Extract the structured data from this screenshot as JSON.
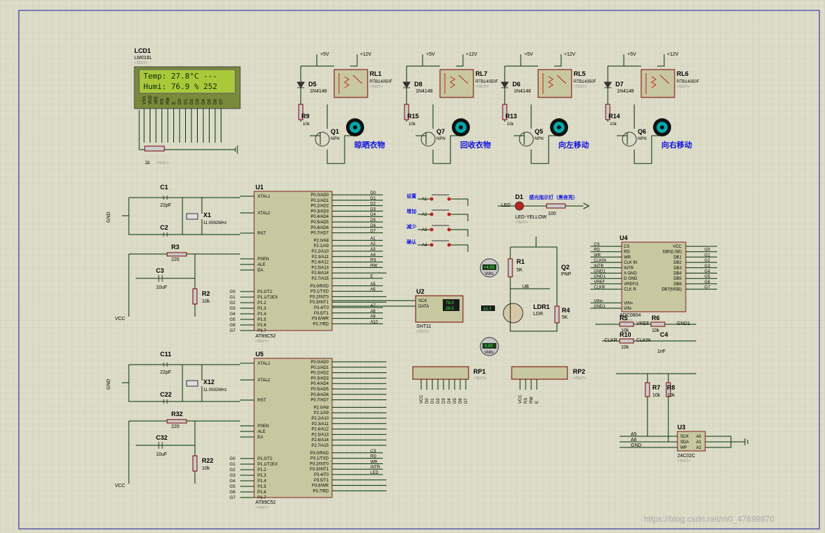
{
  "lcd": {
    "ref": "LCD1",
    "part": "LM016L",
    "line1": "Temp: 27.8°C ---",
    "line2": "Humi: 76.9 % 252",
    "pins": [
      "VSS",
      "VDD",
      "VEE",
      "RS",
      "RW",
      "E",
      "D0",
      "D1",
      "D2",
      "D3",
      "D4",
      "D5",
      "D6",
      "D7"
    ]
  },
  "relays": [
    {
      "diode": "D5",
      "relay": "RL1",
      "part": "RTB14050F",
      "res": "R9",
      "trans": "Q1",
      "label": "晾晒衣物"
    },
    {
      "diode": "D8",
      "relay": "RL7",
      "part": "RTB14050F",
      "res": "R15",
      "trans": "Q7",
      "label": "回收衣物"
    },
    {
      "diode": "D6",
      "relay": "RL5",
      "part": "RTB14050F",
      "res": "R13",
      "trans": "Q5",
      "label": "向左移动"
    },
    {
      "diode": "D7",
      "relay": "RL6",
      "part": "RTB14050F",
      "res": "R14",
      "trans": "Q6",
      "label": "向右移动"
    }
  ],
  "common": {
    "v5": "+5V",
    "v12": "+12V",
    "diode_part": "1N4148",
    "r10k": "10k",
    "npn": "NPN",
    "pnp": "PNP",
    "text": "<TEXT>",
    "gnd": "GND",
    "vcc": "VCC",
    "xtal_freq": "11.0592MHz",
    "cap22": "22pF",
    "cap10u": "10uF",
    "r220": "220",
    "r1k": "1k",
    "r5k": "5K",
    "cap1n": "1nF",
    "r100": "100"
  },
  "u1": {
    "ref": "U1",
    "part": "AT89C52",
    "left": [
      "XTAL1",
      "XTAL2",
      "RST",
      "PSEN",
      "ALE",
      "EA",
      "P1.0/T2",
      "P1.1/T2EX",
      "P1.2",
      "P1.3",
      "P1.4",
      "P1.5",
      "P1.6",
      "P1.7"
    ],
    "right": [
      "P0.0/AD0",
      "P0.1/AD1",
      "P0.2/AD2",
      "P0.3/AD3",
      "P0.4/AD4",
      "P0.5/AD5",
      "P0.6/AD6",
      "P0.7/AD7",
      "P2.0/A8",
      "P2.1/A9",
      "P2.2/A10",
      "P2.3/A11",
      "P2.4/A12",
      "P2.5/A13",
      "P2.6/A14",
      "P2.7/A15",
      "P3.0/RXD",
      "P3.1/TXD",
      "P3.2/INT0",
      "P3.3/INT1",
      "P3.4/T0",
      "P3.5/T1",
      "P3.6/WR",
      "P3.7/RD"
    ],
    "nets_right": [
      "D0",
      "D1",
      "D2",
      "D3",
      "D4",
      "D5",
      "D6",
      "D7",
      "A1",
      "A2",
      "A3",
      "A4",
      "RS",
      "RW",
      "",
      "E",
      "A5",
      "A6",
      "",
      "",
      "A7",
      "A8",
      "A9",
      "A10"
    ],
    "nets_left": [
      "G0",
      "G1",
      "G2",
      "G3",
      "G4",
      "G5",
      "G6",
      "G7"
    ]
  },
  "u5": {
    "ref": "U5",
    "part": "AT89C52",
    "nets_right": [
      "",
      "",
      "",
      "",
      "",
      "",
      "",
      "",
      "",
      "",
      "",
      "",
      "",
      "",
      "",
      "",
      "CS",
      "RD",
      "WR",
      "INTR",
      "LED",
      "",
      "",
      ""
    ]
  },
  "buttons": [
    "设置",
    "增加",
    "减少",
    "确认"
  ],
  "button_nets": [
    "A1",
    "A2",
    "A3",
    "A4"
  ],
  "led": {
    "ref": "D1",
    "part": "LED-YELLOW",
    "net": "LED",
    "label": "感光指示灯（黑夜亮）",
    "res": "R13"
  },
  "sht": {
    "ref": "U2",
    "part": "SHT11",
    "t": "78.0",
    "h": "28.0",
    "pins": [
      "SCK",
      "DATA"
    ]
  },
  "meters": [
    {
      "val": "+4.93",
      "unit": "Volts"
    },
    {
      "val": "0.00",
      "unit": "Volts"
    }
  ],
  "ldr": {
    "ref": "LDR1",
    "part": "LDR",
    "val": "10.7"
  },
  "adc": {
    "ref": "U4",
    "part": "ADC0804",
    "left": [
      "CS",
      "RD",
      "WR",
      "CLK IN",
      "INTR",
      "A GND",
      "D GND",
      "VREF/2",
      "CLK R",
      "VIN+",
      "VIN-"
    ],
    "right": [
      "VCC",
      "DB0(LSB)",
      "DB1",
      "DB2",
      "DB3",
      "DB4",
      "DB5",
      "DB6",
      "DB7(MSB)"
    ],
    "nets_left": [
      "CS",
      "RD",
      "WR",
      "CLKIN",
      "INTR",
      "GND1",
      "GND1",
      "VREF",
      "CLKR",
      "VIN+",
      "GND1"
    ],
    "nets_right": [
      "",
      "G0",
      "G1",
      "G2",
      "G3",
      "G4",
      "G5",
      "G6",
      "G7"
    ]
  },
  "eeprom": {
    "ref": "U3",
    "part": "24C02C",
    "pins": [
      "SCK",
      "SDA",
      "WP",
      "A0",
      "A1",
      "A2"
    ],
    "nets": [
      "A5",
      "A6",
      "GND"
    ]
  },
  "rp": [
    {
      "ref": "RP1",
      "nets": [
        "VCC",
        "D0",
        "D1",
        "D2",
        "D3",
        "D4",
        "D5",
        "D6",
        "D7"
      ]
    },
    {
      "ref": "RP2",
      "nets": [
        "VCC",
        "RS",
        "RW",
        "E"
      ]
    }
  ],
  "parts": {
    "r1": "R1",
    "r2": "R2",
    "r3": "R3",
    "r4": "R4",
    "r5": "R5",
    "r6": "R6",
    "r7": "R7",
    "r8": "R8",
    "r10": "R10",
    "r22": "R22",
    "r32": "R32",
    "q2": "Q2",
    "c1": "C1",
    "c2": "C2",
    "c3": "C3",
    "c4": "C4",
    "c11": "C11",
    "c22": "C22",
    "c32": "C32",
    "x1": "X1",
    "x12": "X12",
    "ub": "UB"
  },
  "watermark": "https://blog.csdn.net/m0_47699870"
}
